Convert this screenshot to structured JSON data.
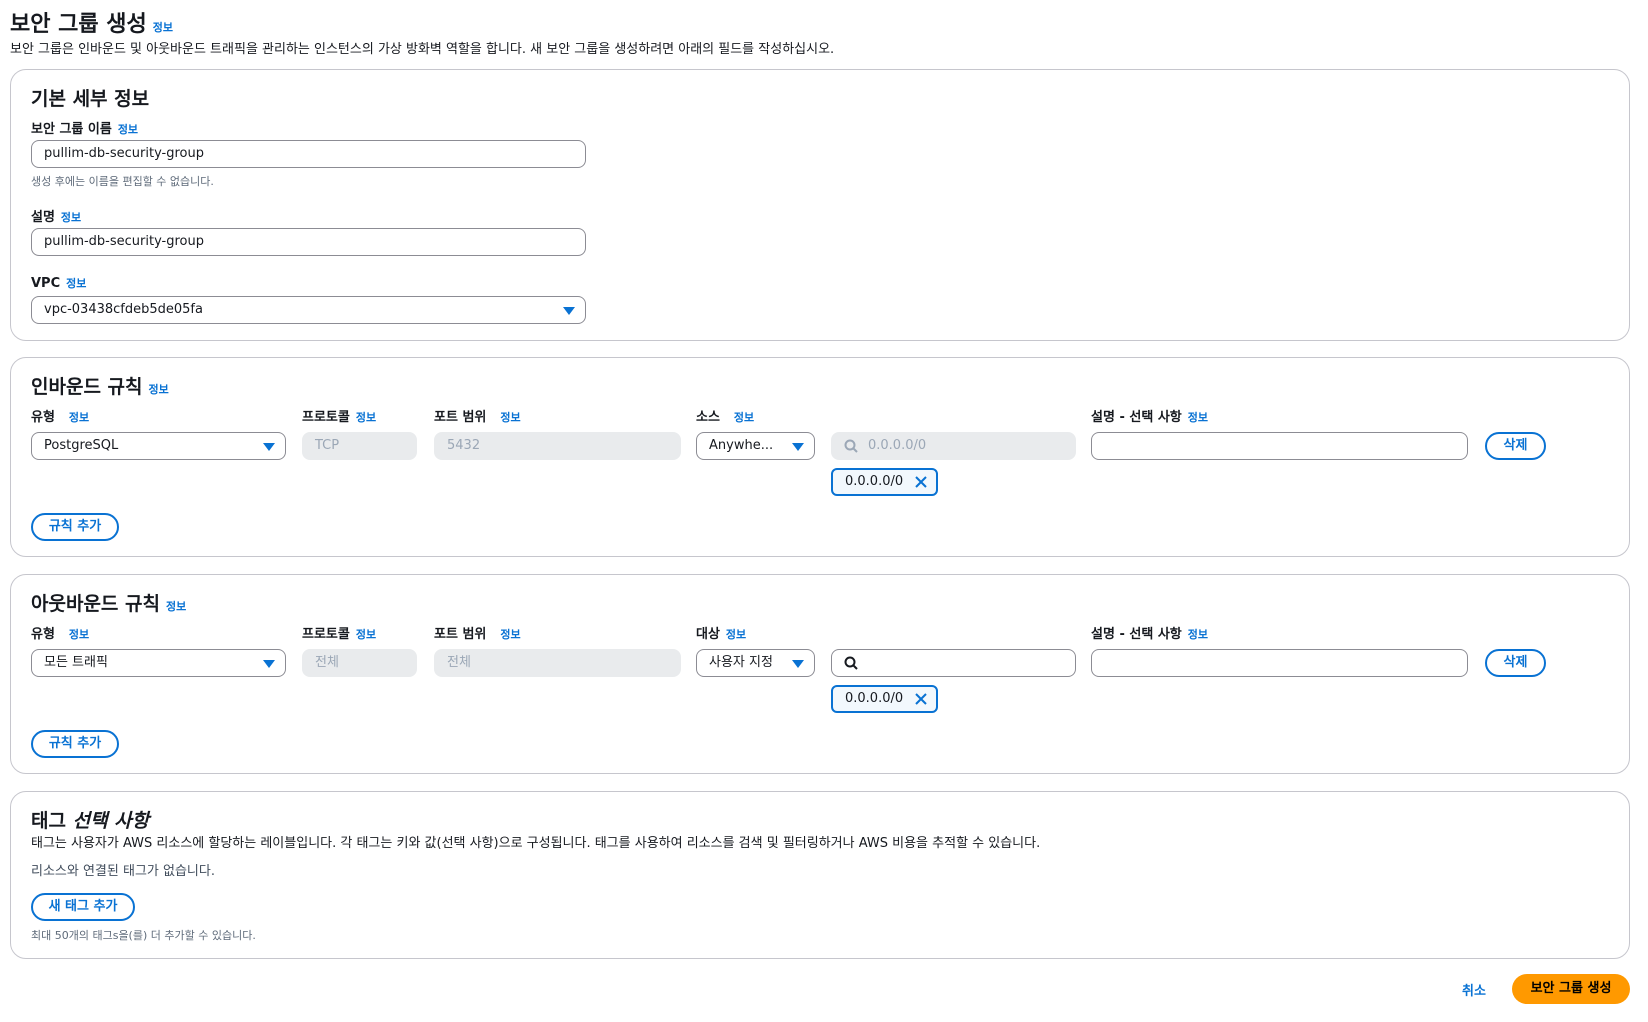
{
  "header": {
    "title": "보안 그룹 생성",
    "info": "정보",
    "description": "보안 그룹은 인바운드 및 아웃바운드 트래픽을 관리하는 인스턴스의 가상 방화벽 역할을 합니다. 새 보안 그룹을 생성하려면 아래의 필드를 작성하십시오."
  },
  "basic": {
    "title": "기본 세부 정보",
    "name_label": "보안 그룹 이름",
    "name_value": "pullim-db-security-group",
    "name_hint": "생성 후에는 이름을 편집할 수 없습니다.",
    "desc_label": "설명",
    "desc_value": "pullim-db-security-group",
    "vpc_label": "VPC",
    "vpc_value": "vpc-03438cfdeb5de05fa"
  },
  "inbound": {
    "title": "인바운드 규칙",
    "col_type": "유형",
    "col_protocol": "프로토콜",
    "col_port": "포트 범위",
    "col_source": "소스",
    "col_desc": "설명 - 선택 사항",
    "type_value": "PostgreSQL",
    "protocol_value": "TCP",
    "port_value": "5432",
    "source_value": "Anywhe...",
    "search_placeholder": "0.0.0.0/0",
    "token": "0.0.0.0/0",
    "delete_label": "삭제",
    "add_rule_label": "규칙 추가"
  },
  "outbound": {
    "title": "아웃바운드 규칙",
    "col_type": "유형",
    "col_protocol": "프로토콜",
    "col_port": "포트 범위",
    "col_dest": "대상",
    "col_desc": "설명 - 선택 사항",
    "type_value": "모든 트래픽",
    "protocol_value": "전체",
    "port_value": "전체",
    "dest_value": "사용자 지정",
    "token": "0.0.0.0/0",
    "delete_label": "삭제",
    "add_rule_label": "규칙 추가"
  },
  "tags": {
    "title": "태그",
    "title_optional": "선택 사항",
    "description": "태그는 사용자가 AWS 리소스에 할당하는 레이블입니다. 각 태그는 키와 값(선택 사항)으로 구성됩니다. 태그를 사용하여 리소스를 검색 및 필터링하거나 AWS 비용을 추적할 수 있습니다.",
    "empty": "리소스와 연결된 태그가 없습니다.",
    "add_label": "새 태그 추가",
    "limit_hint": "최대 50개의 태그s을(를) 더 추가할 수 있습니다."
  },
  "footer": {
    "cancel": "취소",
    "submit": "보안 그룹 생성"
  },
  "colors": {
    "accent": "#0972d3",
    "primary": "#ff9900"
  }
}
